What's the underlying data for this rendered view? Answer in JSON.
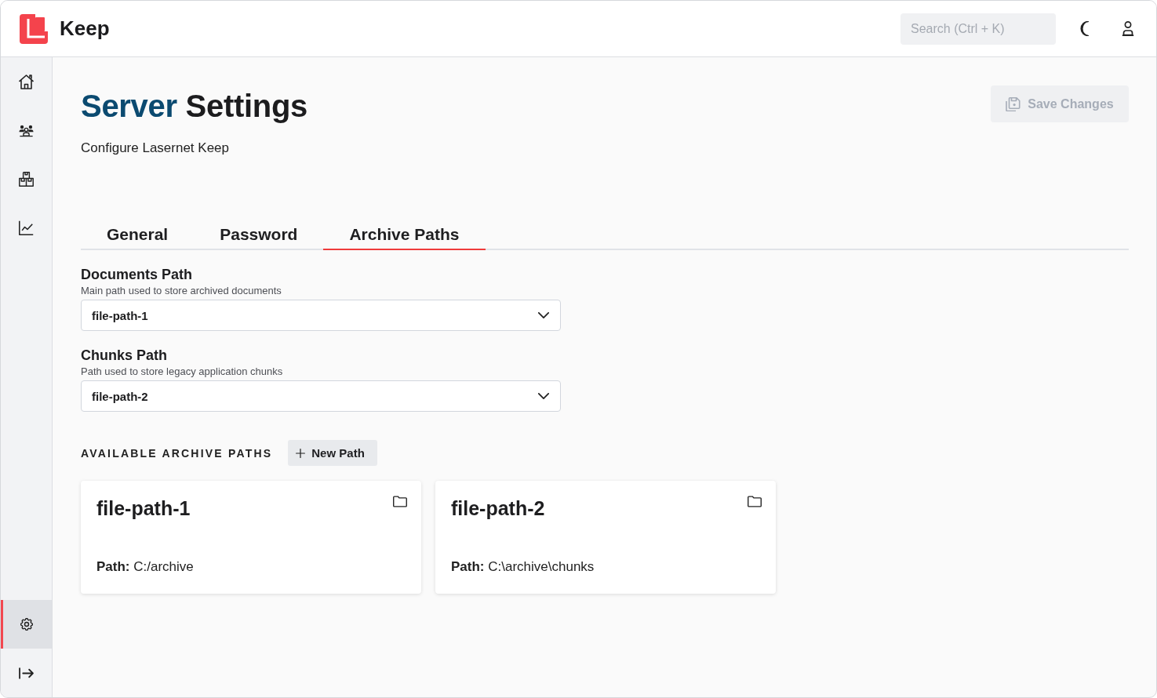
{
  "app": {
    "name": "Keep"
  },
  "search": {
    "placeholder": "Search (Ctrl + K)"
  },
  "sidebar": {
    "items": [
      {
        "selected": false
      },
      {
        "selected": false
      },
      {
        "selected": false
      },
      {
        "selected": false
      }
    ],
    "bottom_items": [
      {
        "selected": true
      },
      {
        "selected": false
      }
    ]
  },
  "page": {
    "title_accent": "Server",
    "title_rest": "Settings",
    "subtitle": "Configure Lasernet Keep",
    "save_button": {
      "label": "Save Changes",
      "disabled": true
    }
  },
  "tabs": [
    {
      "label": "General",
      "selected": false
    },
    {
      "label": "Password",
      "selected": false
    },
    {
      "label": "Archive Paths",
      "selected": true
    }
  ],
  "fields": [
    {
      "label": "Documents Path",
      "description": "Main path used to store archived documents",
      "value": "file-path-1"
    },
    {
      "label": "Chunks Path",
      "description": "Path used to store legacy application chunks",
      "value": "file-path-2"
    }
  ],
  "archive_paths": {
    "heading": "AVAILABLE ARCHIVE PATHS",
    "new_button": "New Path",
    "cards": [
      {
        "name": "file-path-1",
        "path": "**Path:** C:/archive"
      },
      {
        "name": "file-path-2",
        "path": "**Path:** C:\\archive\\chunks"
      }
    ]
  }
}
